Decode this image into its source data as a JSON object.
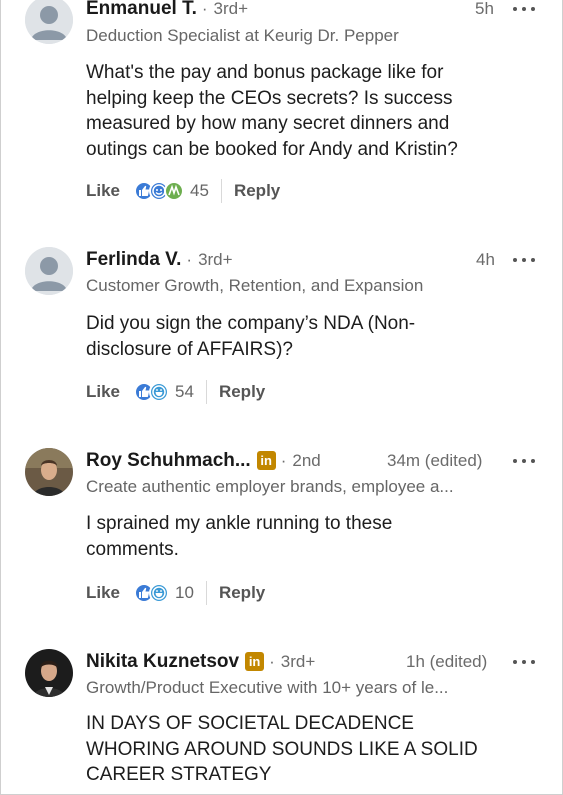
{
  "comments": [
    {
      "name": "Enmanuel T.",
      "degree": "3rd+",
      "separator": "·",
      "time": "5h",
      "headline": "Deduction Specialist at Keurig Dr. Pepper",
      "body": [
        "What's the pay and bonus package like for",
        "helping keep the CEOs secrets? Is success",
        "measured by how many secret dinners and",
        "outings can be booked for Andy and Kristin?"
      ],
      "like_label": "Like",
      "reactions": [
        "like-icon",
        "love-icon",
        "support-icon"
      ],
      "reaction_count": "45",
      "reply_label": "Reply",
      "avatar": "default-avatar"
    },
    {
      "name": "Ferlinda V.",
      "degree": "3rd+",
      "separator": "·",
      "time": "4h",
      "headline": "Customer Growth, Retention, and Expansion",
      "body": [
        "Did you sign the company’s NDA (Non-",
        "disclosure of AFFAIRS)?"
      ],
      "like_label": "Like",
      "reactions": [
        "like-icon",
        "funny-icon"
      ],
      "reaction_count": "54",
      "reply_label": "Reply",
      "avatar": "default-avatar"
    },
    {
      "name": "Roy Schuhmach...",
      "badge": "in",
      "degree": "2nd",
      "separator": "·",
      "time": "34m (edited)",
      "headline": "Create authentic employer brands, employee a...",
      "body": [
        "I sprained my ankle running to these",
        "comments."
      ],
      "like_label": "Like",
      "reactions": [
        "like-icon",
        "funny-icon"
      ],
      "reaction_count": "10",
      "reply_label": "Reply",
      "avatar": "photo-avatar"
    },
    {
      "name": "Nikita Kuznetsov",
      "badge": "in",
      "degree": "3rd+",
      "separator": "·",
      "time": "1h (edited)",
      "headline": "Growth/Product Executive with 10+ years of le...",
      "body": [
        "IN DAYS OF SOCIETAL DECADENCE",
        "WHORING AROUND SOUNDS LIKE A SOLID",
        "CAREER STRATEGY"
      ],
      "avatar": "photo-avatar"
    }
  ],
  "colors": {
    "like": "#3b7bd6",
    "love": "#df704d",
    "support": "#6dae4f",
    "badge": "#c28700"
  }
}
